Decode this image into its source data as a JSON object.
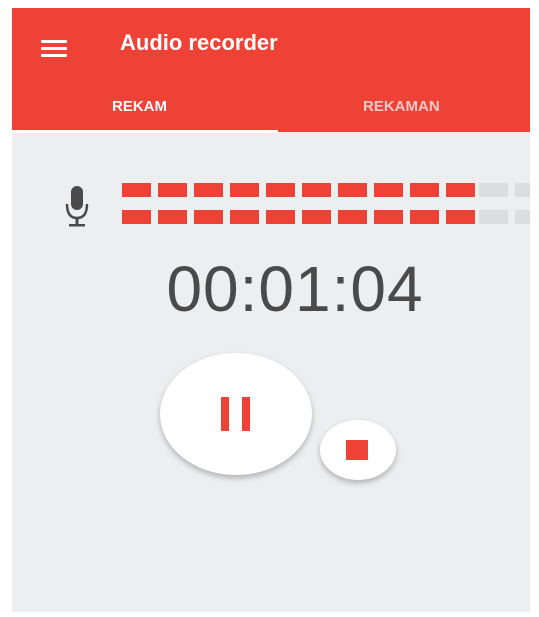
{
  "app": {
    "title": "Audio recorder"
  },
  "tabs": [
    {
      "label": "REKAM",
      "active": true
    },
    {
      "label": "REKAMAN",
      "active": false
    }
  ],
  "recorder": {
    "elapsed_time": "00:01:04",
    "level_meter": {
      "total_segments": 13,
      "active_segments": 10,
      "active_color": "#ef4236",
      "inactive_color": "#dcdddf"
    }
  },
  "icons": {
    "menu": "menu-icon",
    "microphone": "microphone-icon",
    "pause": "pause-icon",
    "stop": "stop-icon"
  },
  "colors": {
    "accent": "#ef4236",
    "background": "#edeeef",
    "text": "#4a4a4a"
  }
}
